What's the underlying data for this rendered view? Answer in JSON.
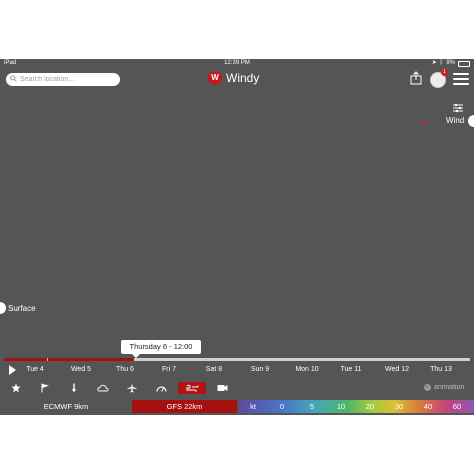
{
  "status_bar": {
    "device": "iPad",
    "time": "12:39 PM",
    "battery": "9%",
    "battery_level": 0.09
  },
  "header": {
    "search_placeholder": "Search location...",
    "app_name": "Windy",
    "notification_count": "1"
  },
  "layer": {
    "name": "Wind"
  },
  "altitude": {
    "label": "Surface"
  },
  "timeline": {
    "selected_label": "Thursday 6 - 12:00",
    "progress": 0.28,
    "days": [
      "Tue 4",
      "Wed 5",
      "Thu 6",
      "Fri 7",
      "Sat 8",
      "Sun 9",
      "Mon 10",
      "Tue 11",
      "Wed 12",
      "Thu 13"
    ]
  },
  "toolbar": {
    "icons": [
      "star-icon",
      "flag-icon",
      "pin-icon",
      "weather-icon",
      "plane-icon",
      "gauge-icon",
      "wind-layer-icon",
      "camera-icon"
    ],
    "animation_label": "animation"
  },
  "models": {
    "ecmwf": "ECMWF 9km",
    "gfs": "GFS 22km"
  },
  "legend": {
    "unit": "kt",
    "values": [
      "0",
      "5",
      "10",
      "20",
      "30",
      "40",
      "60"
    ]
  },
  "colors": {
    "accent": "#a71010",
    "map_background": "#555555"
  }
}
